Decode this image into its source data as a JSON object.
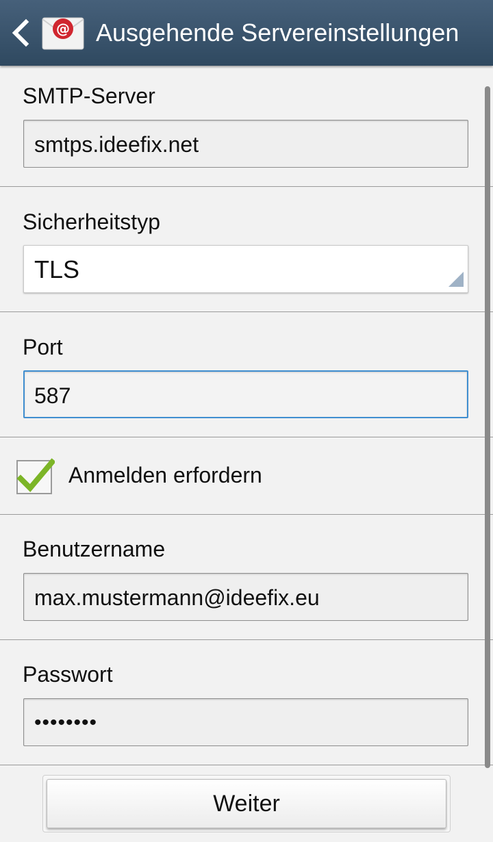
{
  "header": {
    "title": "Ausgehende Servereinstellungen",
    "back_icon": "chevron-left-icon",
    "app_icon": "email-app-icon"
  },
  "smtp": {
    "label": "SMTP-Server",
    "value": "smtps.ideefix.net"
  },
  "security": {
    "label": "Sicherheitstyp",
    "value": "TLS"
  },
  "port": {
    "label": "Port",
    "value": "587"
  },
  "auth": {
    "label": "Anmelden erfordern",
    "checked": true
  },
  "username": {
    "label": "Benutzername",
    "value": "max.mustermann@ideefix.eu"
  },
  "password": {
    "label": "Passwort",
    "value": "••••••••"
  },
  "footer": {
    "next_label": "Weiter"
  },
  "colors": {
    "header": "#3b556d",
    "focus": "#3f8ed0",
    "check": "#7cb527"
  }
}
